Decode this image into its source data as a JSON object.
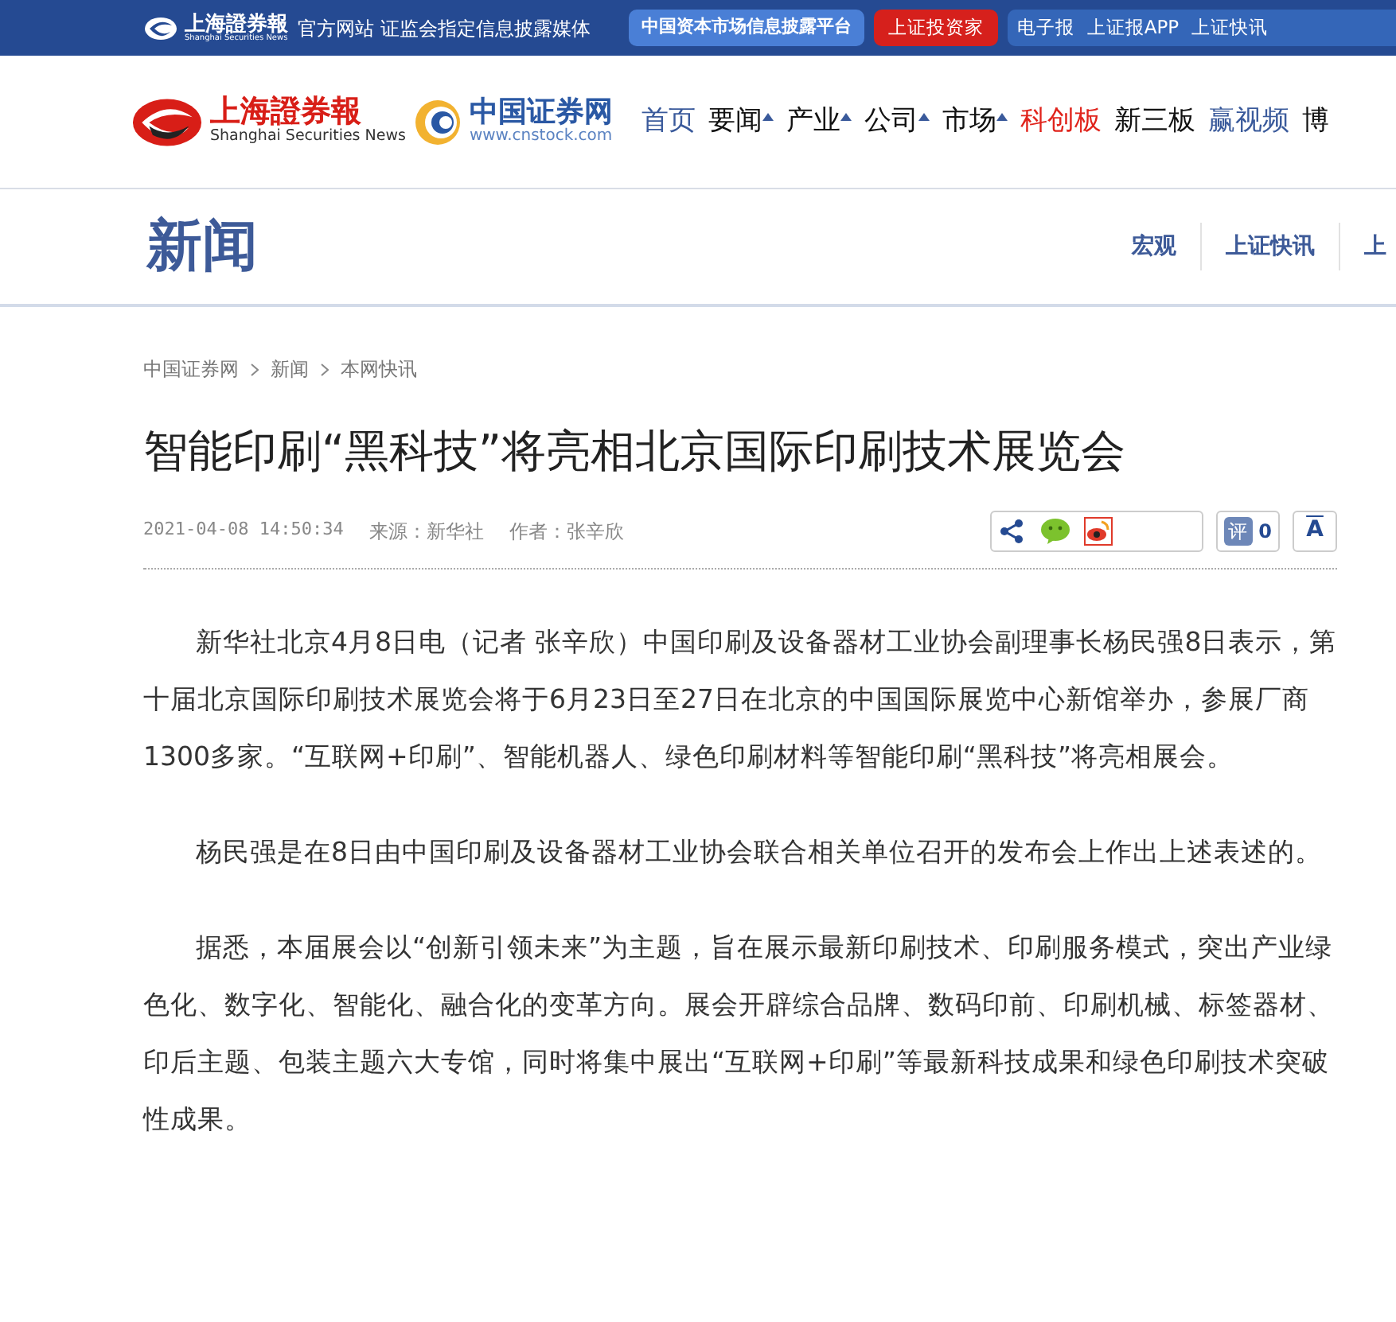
{
  "top_bar": {
    "logo_text": "上海證券報",
    "logo_subtext": "Shanghai Securities News",
    "tagline": "官方网站 证监会指定信息披露媒体",
    "platform_button": "中国资本市场信息披露平台",
    "investor_button": "上证投资家",
    "links": [
      "电子报",
      "上证报APP",
      "上证快讯"
    ]
  },
  "header": {
    "logo_text": "上海證券報",
    "logo_subtext": "Shanghai Securities News",
    "site_name": "中国证券网",
    "site_url": "www.cnstock.com",
    "nav": [
      {
        "label": "首页",
        "dropdown": false,
        "color": "#3a5a9b"
      },
      {
        "label": "要闻",
        "dropdown": true,
        "color": "#111111"
      },
      {
        "label": "产业",
        "dropdown": true,
        "color": "#111111"
      },
      {
        "label": "公司",
        "dropdown": true,
        "color": "#111111"
      },
      {
        "label": "市场",
        "dropdown": true,
        "color": "#111111"
      },
      {
        "label": "科创板",
        "dropdown": false,
        "color": "#e0231b"
      },
      {
        "label": "新三板",
        "dropdown": false,
        "color": "#111111"
      },
      {
        "label": "赢视频",
        "dropdown": false,
        "color": "#3a5a9b"
      },
      {
        "label": "博",
        "dropdown": false,
        "color": "#111111"
      }
    ]
  },
  "section": {
    "title": "新闻",
    "tabs": [
      "宏观",
      "上证快讯",
      "上"
    ]
  },
  "breadcrumb": [
    "中国证券网",
    "新闻",
    "本网快讯"
  ],
  "article": {
    "title": "智能印刷“黑科技”将亮相北京国际印刷技术展览会",
    "datetime": "2021-04-08 14:50:34",
    "source": "来源：新华社",
    "author": "作者：张辛欣",
    "comment_label": "评",
    "comment_count": "0",
    "font_button": "A",
    "paragraphs": [
      "新华社北京4月8日电（记者 张辛欣）中国印刷及设备器材工业协会副理事长杨民强8日表示，第十届北京国际印刷技术展览会将于6月23日至27日在北京的中国国际展览中心新馆举办，参展厂商1300多家。“互联网+印刷”、智能机器人、绿色印刷材料等智能印刷“黑科技”将亮相展会。",
      "杨民强是在8日由中国印刷及设备器材工业协会联合相关单位召开的发布会上作出上述表述的。",
      "据悉，本届展会以“创新引领未来”为主题，旨在展示最新印刷技术、印刷服务模式，突出产业绿色化、数字化、智能化、融合化的变革方向。展会开辟综合品牌、数码印前、印刷机械、标签器材、印后主题、包装主题六大专馆，同时将集中展出“互联网+印刷”等最新科技成果和绿色印刷技术突破性成果。"
    ]
  }
}
